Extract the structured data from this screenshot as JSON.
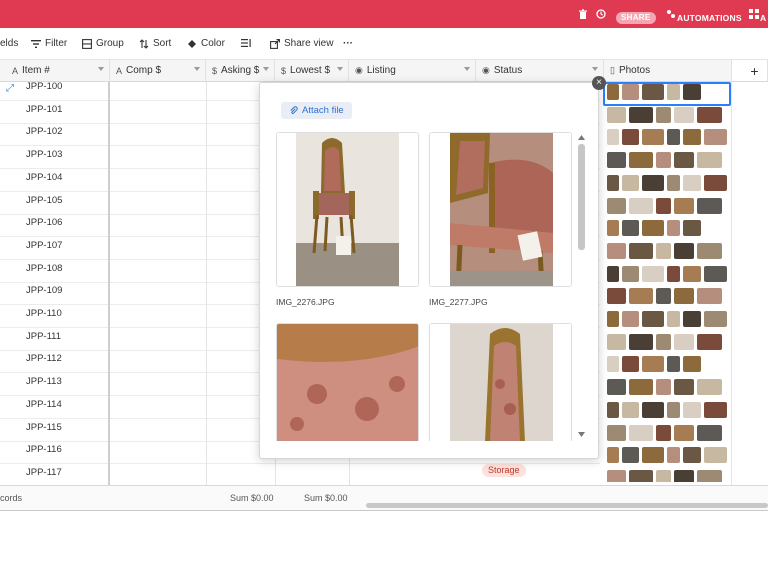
{
  "header": {
    "share_label": "SHARE",
    "automations_label": "AUTOMATIONS",
    "apps_label": "A",
    "accent_color": "#e03a52"
  },
  "toolbar": {
    "fields_label": "elds",
    "filter_label": "Filter",
    "group_label": "Group",
    "sort_label": "Sort",
    "color_label": "Color",
    "share_view_label": "Share view",
    "more_label": "···"
  },
  "columns": {
    "item": "Item #",
    "comp": "Comp $",
    "asking": "Asking $",
    "lowest": "Lowest $",
    "listing": "Listing",
    "status": "Status",
    "photos": "Photos",
    "add": "+"
  },
  "rows": [
    "JPP-100",
    "JPP-101",
    "JPP-102",
    "JPP-103",
    "JPP-104",
    "JPP-105",
    "JPP-106",
    "JPP-107",
    "JPP-108",
    "JPP-109",
    "JPP-110",
    "JPP-111",
    "JPP-112",
    "JPP-113",
    "JPP-114",
    "JPP-115",
    "JPP-116",
    "JPP-117"
  ],
  "status_last_row": "Storage",
  "footer": {
    "records_label": "cords",
    "sum_asking": "Sum $0.00",
    "sum_lowest": "Sum $0.00"
  },
  "popup": {
    "attach_label": "Attach file",
    "files": [
      "IMG_2276.JPG",
      "IMG_2277.JPG"
    ]
  }
}
